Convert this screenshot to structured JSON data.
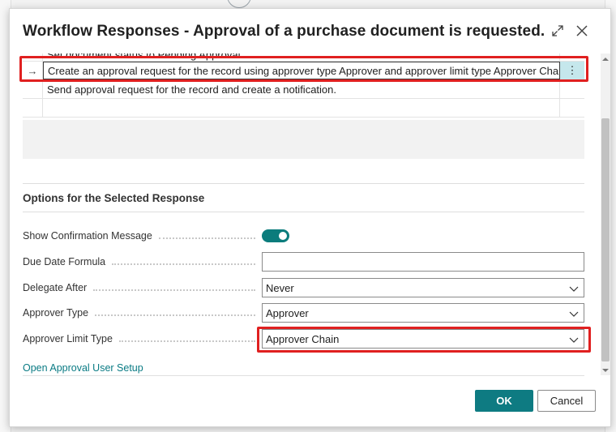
{
  "dialog": {
    "title": "Workflow Responses - Approval of a purchase document is requested.",
    "expand_icon": "expand-icon",
    "close_icon": "close-icon"
  },
  "grid": {
    "rows": [
      {
        "text": "Set document status to Pending Approval.",
        "selected": false
      },
      {
        "text": "Create an approval request for the record using approver type Approver and approver limit type Approver Chain.",
        "selected": true,
        "arrow": "→",
        "menu": "⋯"
      },
      {
        "text": "Send approval request for the record and create a notification.",
        "selected": false
      },
      {
        "text": "",
        "selected": false
      }
    ],
    "row_menu_icon": "⋮"
  },
  "options": {
    "section_title": "Options for the Selected Response",
    "show_confirmation": {
      "label": "Show Confirmation Message",
      "value": true
    },
    "due_date_formula": {
      "label": "Due Date Formula",
      "value": ""
    },
    "delegate_after": {
      "label": "Delegate After",
      "value": "Never"
    },
    "approver_type": {
      "label": "Approver Type",
      "value": "Approver"
    },
    "approver_limit_type": {
      "label": "Approver Limit Type",
      "value": "Approver Chain"
    },
    "setup_link": "Open Approval User Setup"
  },
  "buttons": {
    "ok": "OK",
    "cancel": "Cancel"
  },
  "colors": {
    "accent": "#0e7b82",
    "highlight": "#e02020"
  }
}
